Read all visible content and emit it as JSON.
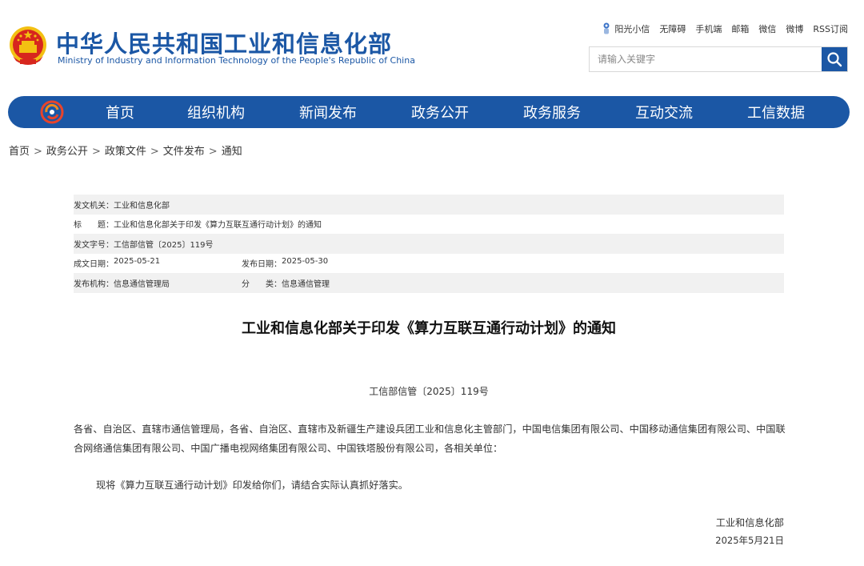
{
  "header": {
    "title_cn": "中华人民共和国工业和信息化部",
    "title_en": "Ministry of Industry and Information Technology of the People's Republic of China",
    "top_links": [
      "阳光小信",
      "无障碍",
      "手机端",
      "邮箱",
      "微信",
      "微博",
      "RSS订阅"
    ],
    "search_placeholder": "请输入关键字",
    "emblem_icon": "national-emblem-icon",
    "search_icon": "search-icon"
  },
  "nav": {
    "items": [
      "首页",
      "组织机构",
      "新闻发布",
      "政务公开",
      "政务服务",
      "互动交流",
      "工信数据"
    ]
  },
  "breadcrumb": [
    "首页",
    "政务公开",
    "政策文件",
    "文件发布",
    "通知"
  ],
  "meta": {
    "issuer_label": "发文机关：",
    "issuer": "工业和信息化部",
    "title_label": "标　　题：",
    "title": "工业和信息化部关于印发《算力互联互通行动计划》的通知",
    "docno_label": "发文字号：",
    "docno": "工信部信管〔2025〕119号",
    "written_label": "成文日期：",
    "written": "2025-05-21",
    "published_label": "发布日期：",
    "published": "2025-05-30",
    "org_label": "发布机构：",
    "org": "信息通信管理局",
    "category_label": "分　　类：",
    "category": "信息通信管理"
  },
  "article": {
    "title": "工业和信息化部关于印发《算力互联互通行动计划》的通知",
    "doc_no": "工信部信管〔2025〕119号",
    "recipients": "各省、自治区、直辖市通信管理局，各省、自治区、直辖市及新疆生产建设兵团工业和信息化主管部门，中国电信集团有限公司、中国移动通信集团有限公司、中国联合网络通信集团有限公司、中国广播电视网络集团有限公司、中国铁塔股份有限公司，各相关单位：",
    "body": "现将《算力互联互通行动计划》印发给你们，请结合实际认真抓好落实。",
    "sign_org": "工业和信息化部",
    "sign_date": "2025年5月21日"
  },
  "colors": {
    "brand_blue": "#1b57a5",
    "emblem_red": "#d7261e",
    "emblem_gold": "#f3c012",
    "row_shade": "#f1f1f1"
  }
}
